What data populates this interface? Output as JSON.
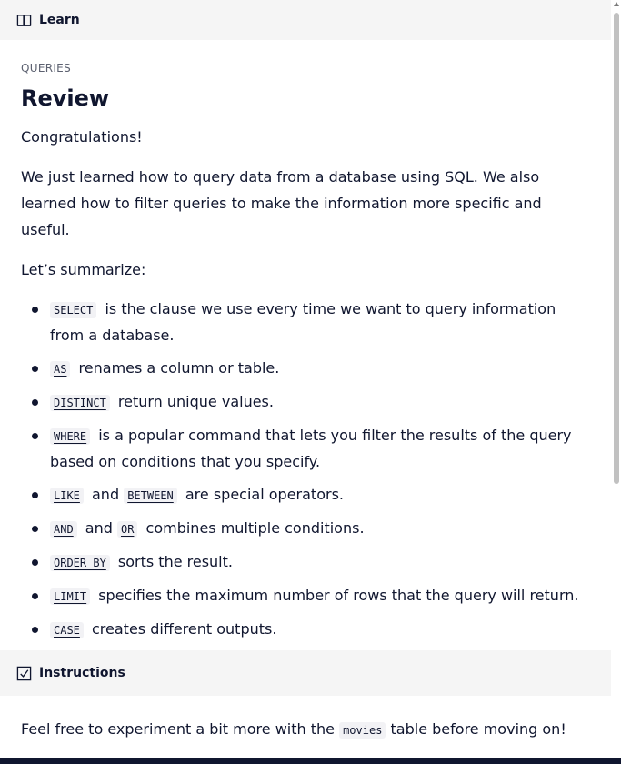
{
  "learn_header": {
    "label": "Learn",
    "icon": "book-icon"
  },
  "lesson": {
    "eyebrow": "QUERIES",
    "title": "Review",
    "intro": "Congratulations!",
    "paragraph": "We just learned how to query data from a database using SQL. We also learned how to filter queries to make the information more specific and useful.",
    "summary_lead": "Let’s summarize:",
    "items": [
      {
        "codes": [
          "SELECT"
        ],
        "text": "is the clause we use every time we want to query information from a database."
      },
      {
        "codes": [
          "AS"
        ],
        "text": "renames a column or table."
      },
      {
        "codes": [
          "DISTINCT"
        ],
        "text": "return unique values."
      },
      {
        "codes": [
          "WHERE"
        ],
        "text": "is a popular command that lets you filter the results of the query based on conditions that you specify."
      },
      {
        "codes": [
          "LIKE",
          "BETWEEN"
        ],
        "joiner": "and",
        "text": "are special operators."
      },
      {
        "codes": [
          "AND",
          "OR"
        ],
        "joiner": "and",
        "text": "combines multiple conditions."
      },
      {
        "codes": [
          "ORDER BY"
        ],
        "text": "sorts the result."
      },
      {
        "codes": [
          "LIMIT"
        ],
        "text": "specifies the maximum number of rows that the query will return."
      },
      {
        "codes": [
          "CASE"
        ],
        "text": "creates different outputs."
      }
    ]
  },
  "instructions_header": {
    "label": "Instructions",
    "icon": "checkbox-icon"
  },
  "instructions": {
    "before": "Feel free to experiment a bit more with the",
    "code": "movies",
    "after": "table before moving on!"
  }
}
